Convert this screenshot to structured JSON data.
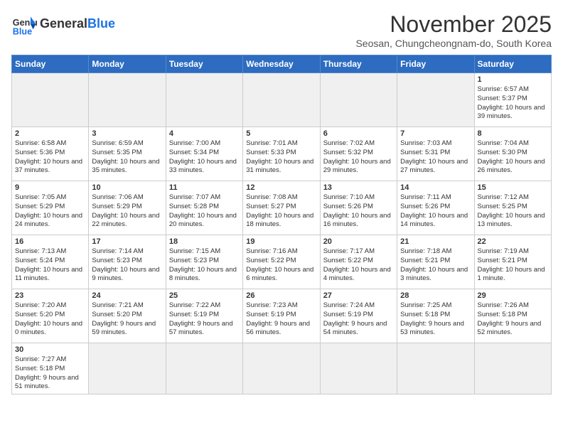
{
  "logo": {
    "text_general": "General",
    "text_blue": "Blue"
  },
  "title": "November 2025",
  "subtitle": "Seosan, Chungcheongnam-do, South Korea",
  "headers": [
    "Sunday",
    "Monday",
    "Tuesday",
    "Wednesday",
    "Thursday",
    "Friday",
    "Saturday"
  ],
  "weeks": [
    [
      {
        "day": "",
        "info": ""
      },
      {
        "day": "",
        "info": ""
      },
      {
        "day": "",
        "info": ""
      },
      {
        "day": "",
        "info": ""
      },
      {
        "day": "",
        "info": ""
      },
      {
        "day": "",
        "info": ""
      },
      {
        "day": "1",
        "info": "Sunrise: 6:57 AM\nSunset: 5:37 PM\nDaylight: 10 hours and 39 minutes."
      }
    ],
    [
      {
        "day": "2",
        "info": "Sunrise: 6:58 AM\nSunset: 5:36 PM\nDaylight: 10 hours and 37 minutes."
      },
      {
        "day": "3",
        "info": "Sunrise: 6:59 AM\nSunset: 5:35 PM\nDaylight: 10 hours and 35 minutes."
      },
      {
        "day": "4",
        "info": "Sunrise: 7:00 AM\nSunset: 5:34 PM\nDaylight: 10 hours and 33 minutes."
      },
      {
        "day": "5",
        "info": "Sunrise: 7:01 AM\nSunset: 5:33 PM\nDaylight: 10 hours and 31 minutes."
      },
      {
        "day": "6",
        "info": "Sunrise: 7:02 AM\nSunset: 5:32 PM\nDaylight: 10 hours and 29 minutes."
      },
      {
        "day": "7",
        "info": "Sunrise: 7:03 AM\nSunset: 5:31 PM\nDaylight: 10 hours and 27 minutes."
      },
      {
        "day": "8",
        "info": "Sunrise: 7:04 AM\nSunset: 5:30 PM\nDaylight: 10 hours and 26 minutes."
      }
    ],
    [
      {
        "day": "9",
        "info": "Sunrise: 7:05 AM\nSunset: 5:29 PM\nDaylight: 10 hours and 24 minutes."
      },
      {
        "day": "10",
        "info": "Sunrise: 7:06 AM\nSunset: 5:29 PM\nDaylight: 10 hours and 22 minutes."
      },
      {
        "day": "11",
        "info": "Sunrise: 7:07 AM\nSunset: 5:28 PM\nDaylight: 10 hours and 20 minutes."
      },
      {
        "day": "12",
        "info": "Sunrise: 7:08 AM\nSunset: 5:27 PM\nDaylight: 10 hours and 18 minutes."
      },
      {
        "day": "13",
        "info": "Sunrise: 7:10 AM\nSunset: 5:26 PM\nDaylight: 10 hours and 16 minutes."
      },
      {
        "day": "14",
        "info": "Sunrise: 7:11 AM\nSunset: 5:26 PM\nDaylight: 10 hours and 14 minutes."
      },
      {
        "day": "15",
        "info": "Sunrise: 7:12 AM\nSunset: 5:25 PM\nDaylight: 10 hours and 13 minutes."
      }
    ],
    [
      {
        "day": "16",
        "info": "Sunrise: 7:13 AM\nSunset: 5:24 PM\nDaylight: 10 hours and 11 minutes."
      },
      {
        "day": "17",
        "info": "Sunrise: 7:14 AM\nSunset: 5:23 PM\nDaylight: 10 hours and 9 minutes."
      },
      {
        "day": "18",
        "info": "Sunrise: 7:15 AM\nSunset: 5:23 PM\nDaylight: 10 hours and 8 minutes."
      },
      {
        "day": "19",
        "info": "Sunrise: 7:16 AM\nSunset: 5:22 PM\nDaylight: 10 hours and 6 minutes."
      },
      {
        "day": "20",
        "info": "Sunrise: 7:17 AM\nSunset: 5:22 PM\nDaylight: 10 hours and 4 minutes."
      },
      {
        "day": "21",
        "info": "Sunrise: 7:18 AM\nSunset: 5:21 PM\nDaylight: 10 hours and 3 minutes."
      },
      {
        "day": "22",
        "info": "Sunrise: 7:19 AM\nSunset: 5:21 PM\nDaylight: 10 hours and 1 minute."
      }
    ],
    [
      {
        "day": "23",
        "info": "Sunrise: 7:20 AM\nSunset: 5:20 PM\nDaylight: 10 hours and 0 minutes."
      },
      {
        "day": "24",
        "info": "Sunrise: 7:21 AM\nSunset: 5:20 PM\nDaylight: 9 hours and 59 minutes."
      },
      {
        "day": "25",
        "info": "Sunrise: 7:22 AM\nSunset: 5:19 PM\nDaylight: 9 hours and 57 minutes."
      },
      {
        "day": "26",
        "info": "Sunrise: 7:23 AM\nSunset: 5:19 PM\nDaylight: 9 hours and 56 minutes."
      },
      {
        "day": "27",
        "info": "Sunrise: 7:24 AM\nSunset: 5:19 PM\nDaylight: 9 hours and 54 minutes."
      },
      {
        "day": "28",
        "info": "Sunrise: 7:25 AM\nSunset: 5:18 PM\nDaylight: 9 hours and 53 minutes."
      },
      {
        "day": "29",
        "info": "Sunrise: 7:26 AM\nSunset: 5:18 PM\nDaylight: 9 hours and 52 minutes."
      }
    ],
    [
      {
        "day": "30",
        "info": "Sunrise: 7:27 AM\nSunset: 5:18 PM\nDaylight: 9 hours and 51 minutes."
      },
      {
        "day": "",
        "info": ""
      },
      {
        "day": "",
        "info": ""
      },
      {
        "day": "",
        "info": ""
      },
      {
        "day": "",
        "info": ""
      },
      {
        "day": "",
        "info": ""
      },
      {
        "day": "",
        "info": ""
      }
    ]
  ]
}
